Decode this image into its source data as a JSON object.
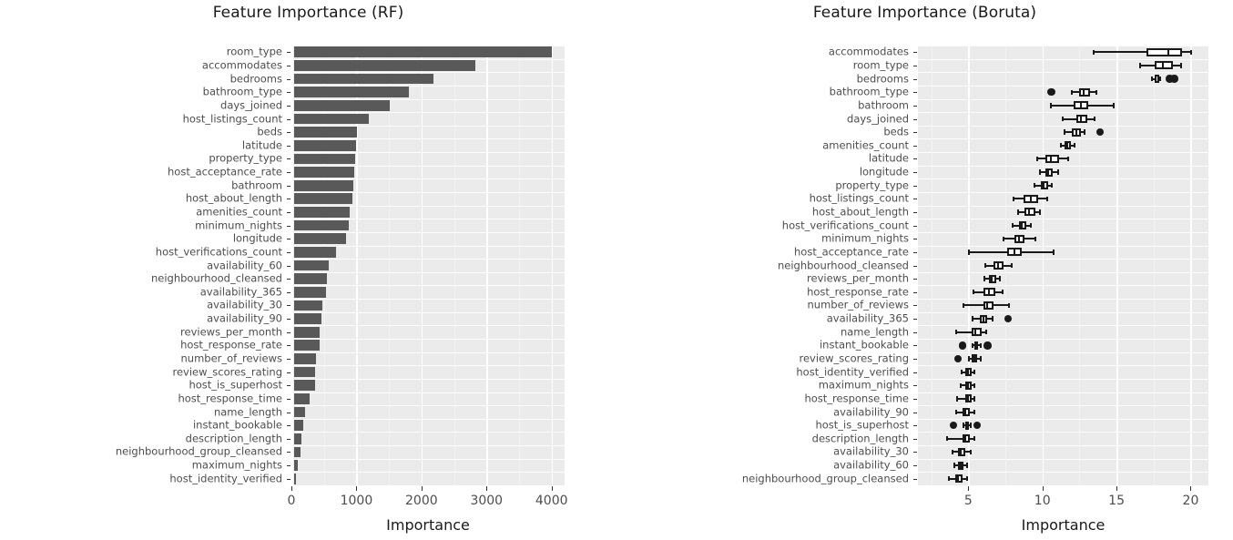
{
  "figure": {
    "background": "#ffffff",
    "panel_background": "#ebebeb",
    "bar_color": "#595959",
    "ink_color": "#1a1a1a",
    "label_color": "#4d4d4d"
  },
  "panels": [
    {
      "id": "rf",
      "title": "Feature Importance (RF)",
      "xlabel": "Importance"
    },
    {
      "id": "boruta",
      "title": "Feature Importance (Boruta)",
      "xlabel": "Importance"
    }
  ],
  "chart_data": [
    {
      "type": "bar",
      "title": "Feature Importance (RF)",
      "xlabel": "Importance",
      "ylabel": "",
      "orientation": "horizontal",
      "xlim": [
        0,
        4200
      ],
      "xticks": [
        0,
        1000,
        2000,
        3000,
        4000
      ],
      "xticklabels": [
        "0",
        "1000",
        "2000",
        "3000",
        "4000"
      ],
      "grid": true,
      "legend": "none",
      "categories": [
        "room_type",
        "accommodates",
        "bedrooms",
        "bathroom_type",
        "days_joined",
        "host_listings_count",
        "beds",
        "latitude",
        "property_type",
        "host_acceptance_rate",
        "bathroom",
        "host_about_length",
        "amenities_count",
        "minimum_nights",
        "longitude",
        "host_verifications_count",
        "availability_60",
        "neighbourhood_cleansed",
        "availability_365",
        "availability_30",
        "availability_90",
        "reviews_per_month",
        "host_response_rate",
        "number_of_reviews",
        "review_scores_rating",
        "host_is_superhost",
        "host_response_time",
        "name_length",
        "instant_bookable",
        "description_length",
        "neighbourhood_group_cleansed",
        "maximum_nights",
        "host_identity_verified"
      ],
      "values": [
        4010,
        2830,
        2190,
        1810,
        1510,
        1190,
        1010,
        1000,
        980,
        960,
        950,
        940,
        900,
        880,
        840,
        680,
        580,
        540,
        530,
        470,
        460,
        440,
        430,
        380,
        370,
        360,
        280,
        210,
        180,
        160,
        140,
        95,
        60
      ]
    },
    {
      "type": "boxplot",
      "title": "Feature Importance (Boruta)",
      "xlabel": "Importance",
      "ylabel": "",
      "orientation": "horizontal",
      "xlim": [
        1.6,
        21.2
      ],
      "xticks": [
        5,
        10,
        15,
        20
      ],
      "xticklabels": [
        "5",
        "10",
        "15",
        "20"
      ],
      "grid": true,
      "legend": "none",
      "categories": [
        "accommodates",
        "room_type",
        "bedrooms",
        "bathroom_type",
        "bathroom",
        "days_joined",
        "beds",
        "amenities_count",
        "latitude",
        "longitude",
        "property_type",
        "host_listings_count",
        "host_about_length",
        "host_verifications_count",
        "minimum_nights",
        "host_acceptance_rate",
        "neighbourhood_cleansed",
        "reviews_per_month",
        "host_response_rate",
        "number_of_reviews",
        "availability_365",
        "name_length",
        "instant_bookable",
        "review_scores_rating",
        "host_identity_verified",
        "maximum_nights",
        "host_response_time",
        "availability_90",
        "host_is_superhost",
        "description_length",
        "availability_30",
        "availability_60",
        "neighbourhood_group_cleansed"
      ],
      "boxes": [
        {
          "label": "accommodates",
          "min": 13.4,
          "q1": 17.0,
          "med": 18.5,
          "q3": 19.4,
          "max": 20.1,
          "outliers": []
        },
        {
          "label": "room_type",
          "min": 16.5,
          "q1": 17.6,
          "med": 18.1,
          "q3": 18.8,
          "max": 19.4,
          "outliers": []
        },
        {
          "label": "bedrooms",
          "min": 17.3,
          "q1": 17.6,
          "med": 17.8,
          "q3": 17.9,
          "max": 18.0,
          "outliers": [
            18.6,
            18.9
          ]
        },
        {
          "label": "bathroom_type",
          "min": 11.9,
          "q1": 12.5,
          "med": 12.8,
          "q3": 13.2,
          "max": 13.7,
          "outliers": [
            10.6
          ]
        },
        {
          "label": "bathroom",
          "min": 10.5,
          "q1": 12.1,
          "med": 12.6,
          "q3": 13.1,
          "max": 14.9,
          "outliers": []
        },
        {
          "label": "days_joined",
          "min": 11.3,
          "q1": 12.3,
          "med": 12.6,
          "q3": 13.0,
          "max": 13.6,
          "outliers": []
        },
        {
          "label": "beds",
          "min": 11.4,
          "q1": 12.0,
          "med": 12.3,
          "q3": 12.6,
          "max": 12.9,
          "outliers": [
            13.9
          ]
        },
        {
          "label": "amenities_count",
          "min": 11.2,
          "q1": 11.5,
          "med": 11.7,
          "q3": 11.9,
          "max": 12.2,
          "outliers": []
        },
        {
          "label": "latitude",
          "min": 9.6,
          "q1": 10.2,
          "med": 10.6,
          "q3": 11.1,
          "max": 11.8,
          "outliers": []
        },
        {
          "label": "longitude",
          "min": 9.8,
          "q1": 10.2,
          "med": 10.4,
          "q3": 10.7,
          "max": 11.1,
          "outliers": []
        },
        {
          "label": "property_type",
          "min": 9.4,
          "q1": 9.9,
          "med": 10.1,
          "q3": 10.4,
          "max": 10.7,
          "outliers": []
        },
        {
          "label": "host_listings_count",
          "min": 8.0,
          "q1": 8.7,
          "med": 9.2,
          "q3": 9.7,
          "max": 10.4,
          "outliers": []
        },
        {
          "label": "host_about_length",
          "min": 8.3,
          "q1": 8.8,
          "med": 9.1,
          "q3": 9.5,
          "max": 9.9,
          "outliers": []
        },
        {
          "label": "host_verifications_count",
          "min": 7.9,
          "q1": 8.4,
          "med": 8.6,
          "q3": 8.9,
          "max": 9.3,
          "outliers": []
        },
        {
          "label": "minimum_nights",
          "min": 7.3,
          "q1": 8.1,
          "med": 8.4,
          "q3": 8.8,
          "max": 9.6,
          "outliers": []
        },
        {
          "label": "host_acceptance_rate",
          "min": 5.0,
          "q1": 7.6,
          "med": 8.1,
          "q3": 8.6,
          "max": 10.8,
          "outliers": []
        },
        {
          "label": "neighbourhood_cleansed",
          "min": 6.1,
          "q1": 6.7,
          "med": 7.0,
          "q3": 7.4,
          "max": 8.0,
          "outliers": []
        },
        {
          "label": "reviews_per_month",
          "min": 6.0,
          "q1": 6.4,
          "med": 6.6,
          "q3": 6.9,
          "max": 7.2,
          "outliers": []
        },
        {
          "label": "host_response_rate",
          "min": 5.3,
          "q1": 6.0,
          "med": 6.4,
          "q3": 6.8,
          "max": 7.4,
          "outliers": []
        },
        {
          "label": "number_of_reviews",
          "min": 4.6,
          "q1": 6.0,
          "med": 6.3,
          "q3": 6.7,
          "max": 7.8,
          "outliers": []
        },
        {
          "label": "availability_365",
          "min": 5.2,
          "q1": 5.8,
          "med": 6.0,
          "q3": 6.3,
          "max": 6.7,
          "outliers": [
            7.7
          ]
        },
        {
          "label": "name_length",
          "min": 4.1,
          "q1": 5.2,
          "med": 5.5,
          "q3": 5.9,
          "max": 6.3,
          "outliers": []
        },
        {
          "label": "instant_bookable",
          "min": 5.2,
          "q1": 5.4,
          "med": 5.5,
          "q3": 5.6,
          "max": 5.9,
          "outliers": [
            4.6,
            6.3
          ]
        },
        {
          "label": "review_scores_rating",
          "min": 5.0,
          "q1": 5.2,
          "med": 5.4,
          "q3": 5.6,
          "max": 5.9,
          "outliers": [
            4.3
          ]
        },
        {
          "label": "host_identity_verified",
          "min": 4.5,
          "q1": 4.8,
          "med": 5.0,
          "q3": 5.2,
          "max": 5.5,
          "outliers": []
        },
        {
          "label": "maximum_nights",
          "min": 4.4,
          "q1": 4.8,
          "med": 5.0,
          "q3": 5.2,
          "max": 5.5,
          "outliers": []
        },
        {
          "label": "host_response_time",
          "min": 4.2,
          "q1": 4.8,
          "med": 5.0,
          "q3": 5.2,
          "max": 5.5,
          "outliers": []
        },
        {
          "label": "availability_90",
          "min": 4.1,
          "q1": 4.6,
          "med": 4.8,
          "q3": 5.1,
          "max": 5.5,
          "outliers": []
        },
        {
          "label": "host_is_superhost",
          "min": 4.6,
          "q1": 4.8,
          "med": 4.9,
          "q3": 5.0,
          "max": 5.2,
          "outliers": [
            4.0,
            5.6
          ]
        },
        {
          "label": "description_length",
          "min": 3.5,
          "q1": 4.6,
          "med": 4.8,
          "q3": 5.1,
          "max": 5.5,
          "outliers": []
        },
        {
          "label": "availability_30",
          "min": 3.9,
          "q1": 4.3,
          "med": 4.5,
          "q3": 4.8,
          "max": 5.2,
          "outliers": []
        },
        {
          "label": "availability_60",
          "min": 4.0,
          "q1": 4.3,
          "med": 4.5,
          "q3": 4.7,
          "max": 5.0,
          "outliers": []
        },
        {
          "label": "neighbourhood_group_cleansed",
          "min": 3.6,
          "q1": 4.1,
          "med": 4.3,
          "q3": 4.6,
          "max": 5.0,
          "outliers": []
        }
      ]
    }
  ]
}
